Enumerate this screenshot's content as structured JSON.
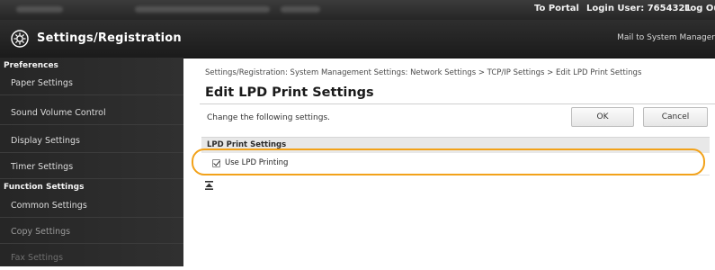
{
  "topbar": {
    "portal_link": "To Portal",
    "login_user": "Login User: 7654321",
    "logout_link": "Log Out"
  },
  "header": {
    "title": "Settings/Registration",
    "mailto": "Mail to System Manager",
    "logo_icon": "settings-gear-icon"
  },
  "sidebar": {
    "sections": [
      {
        "label": "Preferences"
      },
      {
        "label": "Function Settings"
      }
    ],
    "preferences_items": [
      {
        "label": "Paper Settings"
      },
      {
        "label": "Sound Volume Control"
      },
      {
        "label": "Display Settings"
      },
      {
        "label": "Timer Settings"
      }
    ],
    "function_items": [
      {
        "label": "Common Settings"
      },
      {
        "label": "Copy Settings"
      },
      {
        "label": "Fax Settings"
      }
    ]
  },
  "main": {
    "breadcrumb": "Settings/Registration: System Management Settings: Network Settings > TCP/IP Settings > Edit LPD Print Settings",
    "page_title": "Edit LPD Print Settings",
    "instruction": "Change the following settings.",
    "ok_label": "OK",
    "cancel_label": "Cancel",
    "section_title": "LPD Print Settings",
    "use_lpd_label": "Use LPD Printing",
    "use_lpd_checked": true,
    "top_anchor_icon": "top-anchor-icon"
  },
  "colors": {
    "highlight": "#f2a21a",
    "header_bg": "#1f1f1f",
    "sidebar_bg": "#2b2b2b"
  }
}
